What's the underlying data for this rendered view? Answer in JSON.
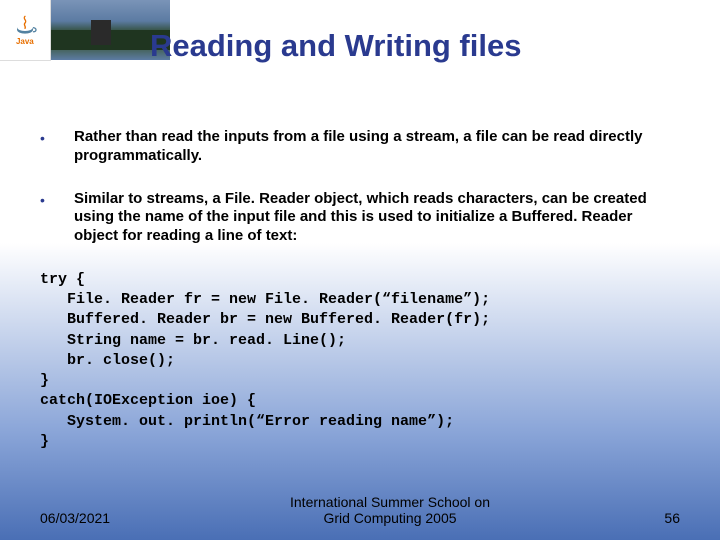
{
  "logo": {
    "text": "Java"
  },
  "title": "Reading and Writing files",
  "bullets": [
    "Rather than read the inputs from a file using a stream, a file can be read directly programmatically.",
    "Similar to streams, a File. Reader object, which reads characters, can be created using the name of the input file and this is used to initialize a Buffered. Reader object for reading a line of text:"
  ],
  "code": "try {\n   File. Reader fr = new File. Reader(“filename”);\n   Buffered. Reader br = new Buffered. Reader(fr);\n   String name = br. read. Line();\n   br. close();\n}\ncatch(IOException ioe) {\n   System. out. println(“Error reading name”);\n}",
  "footer": {
    "date": "06/03/2021",
    "center_line1": "International Summer School on",
    "center_line2": "Grid Computing 2005",
    "page": "56"
  }
}
